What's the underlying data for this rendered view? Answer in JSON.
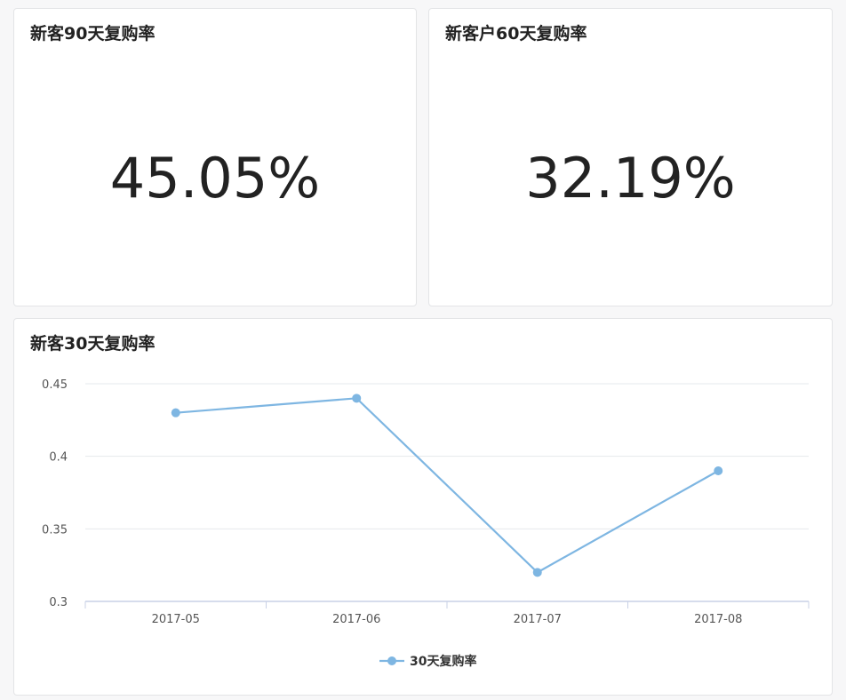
{
  "kpi_cards": [
    {
      "title": "新客90天复购率",
      "value": "45.05%"
    },
    {
      "title": "新客户60天复购率",
      "value": "32.19%"
    }
  ],
  "chart_card": {
    "title": "新客30天复购率"
  },
  "chart_data": {
    "type": "line",
    "title": "新客30天复购率",
    "xlabel": "",
    "ylabel": "",
    "categories": [
      "2017-05",
      "2017-06",
      "2017-07",
      "2017-08"
    ],
    "series": [
      {
        "name": "30天复购率",
        "values": [
          0.43,
          0.44,
          0.32,
          0.39
        ]
      }
    ],
    "ylim": [
      0.3,
      0.45
    ],
    "yticks": [
      "0.3",
      "0.35",
      "0.4",
      "0.45"
    ],
    "grid": true,
    "legend_position": "bottom-center",
    "colors": {
      "series": "#7eb6e2",
      "grid": "#e6e8ec",
      "axis": "#c9d1e6",
      "tick_text": "#555555"
    }
  }
}
